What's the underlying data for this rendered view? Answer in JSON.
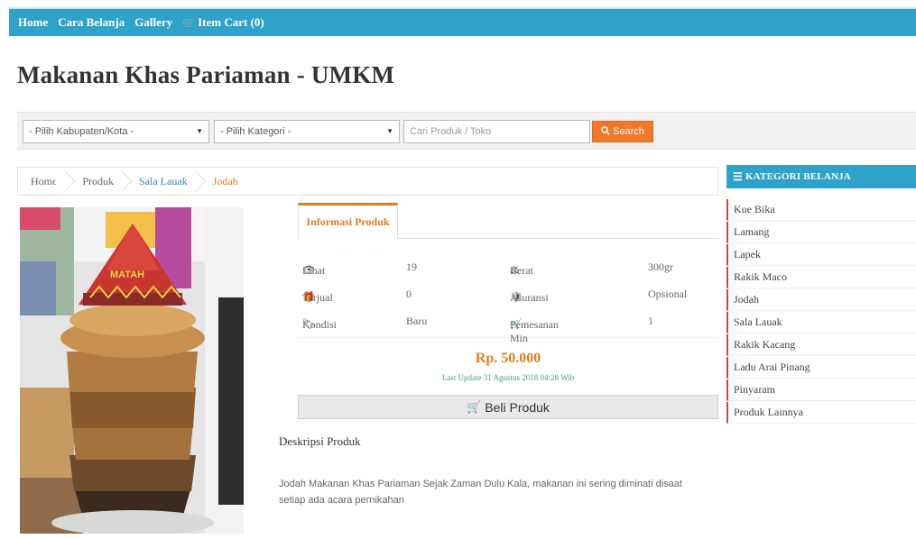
{
  "nav": {
    "home": "Home",
    "cara_belanja": "Cara Belanja",
    "gallery": "Gallery",
    "cart": "Item Cart (0)"
  },
  "site_title": "Makanan Khas Pariaman - UMKM",
  "filters": {
    "kabupaten": "- Pilih Kabupaten/Kota -",
    "kategori": "- Pilih Kategori -",
    "search_placeholder": "Cari Produk / Toko",
    "search_button": "Search"
  },
  "breadcrumb": [
    "Home",
    "Produk",
    "Sala Lauak",
    "Jodah"
  ],
  "product": {
    "tab": "Informasi Produk",
    "rows": [
      {
        "label1": "Lihat",
        "value1": "19",
        "label2": "Berat",
        "value2": "300gr"
      },
      {
        "label1": "Terjual",
        "value1": "0",
        "label2": "Asuransi",
        "value2": "Opsional"
      },
      {
        "label1": "Kondisi",
        "value1": "Baru",
        "label2": "Pemesanan Min",
        "value2": "1"
      }
    ],
    "price": "Rp. 50.000",
    "last_update": "Last Update 31 Agustus 2018 04:28 Wib",
    "buy_button": "Beli Produk",
    "desc_title": "Deskripsi Produk",
    "desc_text": "Jodah Makanan Khas Pariaman Sejak Zaman Dulu Kala, makanan ini sering diminati disaat setiap ada acara pernikahan",
    "image_sign": "MATAH"
  },
  "sidebar": {
    "title": "KATEGORI BELANJA",
    "items": [
      "Kue Bika",
      "Lamang",
      "Lapek",
      "Rakik Maco",
      "Jodah",
      "Sala Lauak",
      "Rakik Kacang",
      "Ladu Arai Pinang",
      "Pinyaram",
      "Produk Lainnya"
    ]
  },
  "colors": {
    "primary": "#2ea2c9",
    "accent": "#e07b22",
    "search_button": "#f0782a",
    "sidebar_marker": "#c64545"
  }
}
